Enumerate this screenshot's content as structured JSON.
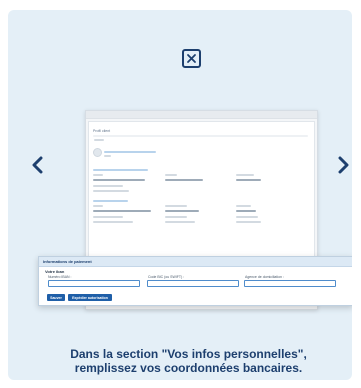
{
  "modal": {
    "close_icon": "close-icon",
    "prev_icon": "chevron-left-icon",
    "next_icon": "chevron-right-icon",
    "caption_line1": "Dans la section \"Vos infos personnelles\",",
    "caption_line2": "remplissez vos coordonnées bancaires.",
    "accent_color": "#1d3f6e",
    "background_color": "#e4eff7"
  },
  "mockup": {
    "page_title": "Profil client",
    "dialog": {
      "title": "Informations de paiement",
      "section_title": "Votre iban",
      "fields": [
        {
          "label": "Numéro IBAN :"
        },
        {
          "label": "Code BIC (ou SWIFT) :"
        },
        {
          "label": "Agence de domiciliation :"
        }
      ],
      "buttons": [
        {
          "label": "Sauver"
        },
        {
          "label": "Expédier autorisation"
        }
      ],
      "button_color": "#1f5fa8",
      "input_border_color": "#4f8ccb"
    }
  }
}
